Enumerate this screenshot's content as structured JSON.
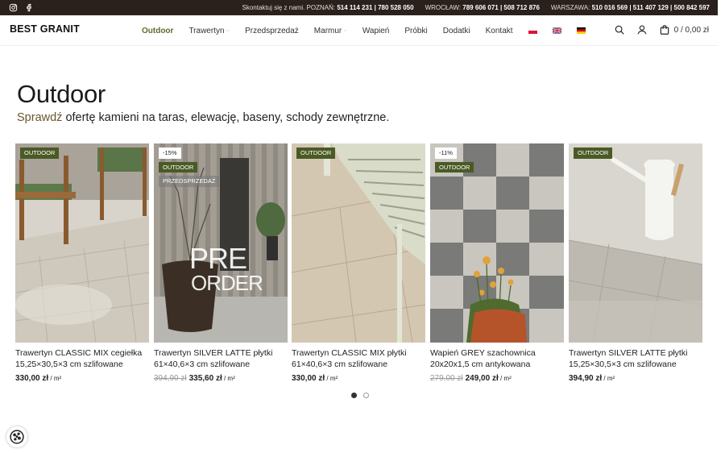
{
  "topbar": {
    "social": [
      "instagram-icon",
      "facebook-icon"
    ],
    "contact_intro": "Skontaktuj się z nami.",
    "groups": [
      {
        "city": "POZNAŃ:",
        "numbers": "514 114 231 | 780 528 050"
      },
      {
        "city": "WROCŁAW:",
        "numbers": "789 606 071 | 508 712 876"
      },
      {
        "city": "WARSZAWA:",
        "numbers": "510 016 569 | 511 407 129 | 500 842 597"
      }
    ]
  },
  "header": {
    "logo": "BEST GRANIT",
    "nav": [
      {
        "label": "Outdoor",
        "active": true,
        "dropdown": false
      },
      {
        "label": "Trawertyn",
        "active": false,
        "dropdown": true
      },
      {
        "label": "Przedsprzedaż",
        "active": false,
        "dropdown": false
      },
      {
        "label": "Marmur",
        "active": false,
        "dropdown": true
      },
      {
        "label": "Wapień",
        "active": false,
        "dropdown": false
      },
      {
        "label": "Próbki",
        "active": false,
        "dropdown": false
      },
      {
        "label": "Dodatki",
        "active": false,
        "dropdown": false
      },
      {
        "label": "Kontakt",
        "active": false,
        "dropdown": false
      }
    ],
    "languages": [
      "pl-flag-icon",
      "en-flag-icon",
      "de-flag-icon"
    ],
    "cart_label": "0 / 0,00 zł",
    "icons": [
      "search-icon",
      "user-icon",
      "cart-icon"
    ]
  },
  "hero": {
    "title": "Outdoor",
    "subtitle_accent": "Sprawdź",
    "subtitle_rest": " ofertę kamieni na taras, elewację, baseny, schody zewnętrzne."
  },
  "products": [
    {
      "badges": [
        {
          "type": "out",
          "text": "OUTDOOR"
        }
      ],
      "name": "Trawertyn CLASSIC MIX cegiełka 15,25×30,5×3 cm szlifowane",
      "old_price": "",
      "price": "330,00 zł",
      "unit": " / m²"
    },
    {
      "badges": [
        {
          "type": "pct",
          "text": "-15%"
        },
        {
          "type": "out",
          "text": "OUTDOOR"
        },
        {
          "type": "pre",
          "text": "PRZEDSPRZEDAŻ"
        }
      ],
      "name": "Trawertyn SILVER LATTE płytki 61×40,6×3 cm szlifowane",
      "old_price": "394,90 zł",
      "price": "335,60 zł",
      "unit": " / m²",
      "overlay_text_1": "PRE",
      "overlay_text_2": "ORDER"
    },
    {
      "badges": [
        {
          "type": "out",
          "text": "OUTDOOR"
        }
      ],
      "name": "Trawertyn CLASSIC MIX płytki 61×40,6×3 cm szlifowane",
      "old_price": "",
      "price": "330,00 zł",
      "unit": " / m²"
    },
    {
      "badges": [
        {
          "type": "pct",
          "text": "-11%"
        },
        {
          "type": "out",
          "text": "OUTDOOR"
        }
      ],
      "name": "Wapień GREY szachownica 20x20x1,5 cm antykowana",
      "old_price": "279,00 zł",
      "price": "249,00 zł",
      "unit": " / m²"
    },
    {
      "badges": [
        {
          "type": "out",
          "text": "OUTDOOR"
        }
      ],
      "name": "Trawertyn SILVER LATTE płytki 15,25×30,5×3 cm szlifowane",
      "old_price": "",
      "price": "394,90 zł",
      "unit": " / m²"
    }
  ],
  "carousel": {
    "pages": 2,
    "active": 0
  },
  "colors": {
    "topbar": "#2b211c",
    "accent": "#5d6b2e",
    "badge_outdoor": "#4a5a25",
    "subtitle_accent": "#6b5528"
  }
}
